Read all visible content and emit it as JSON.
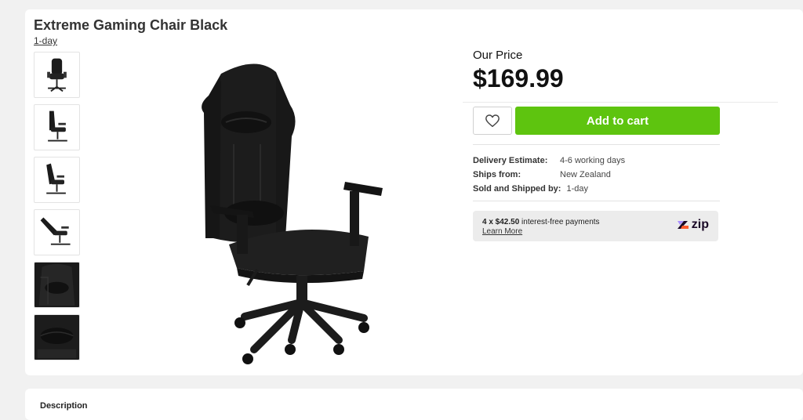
{
  "product": {
    "title": "Extreme Gaming Chair Black",
    "seller": "1-day",
    "thumbnails": [
      "thumbnail-front",
      "thumbnail-side",
      "thumbnail-side-recline",
      "thumbnail-full-recline",
      "thumbnail-headrest-detail",
      "thumbnail-lumbar-detail"
    ]
  },
  "pricing": {
    "label": "Our Price",
    "price": "$169.99"
  },
  "actions": {
    "wishlist_icon": "heart-icon",
    "add_to_cart": "Add to cart"
  },
  "details": {
    "delivery_label": "Delivery Estimate:",
    "delivery_value": "4-6 working days",
    "ships_label": "Ships from:",
    "ships_value": "New Zealand",
    "sold_label": "Sold and Shipped by:",
    "sold_value": "1-day"
  },
  "zip": {
    "amount": "4 x $42.50",
    "text": "interest-free payments",
    "learn_more": "Learn More",
    "logo": "zip"
  },
  "description": {
    "title": "Description"
  },
  "colors": {
    "accent": "#5ec40f",
    "background": "#f1f1f1"
  }
}
